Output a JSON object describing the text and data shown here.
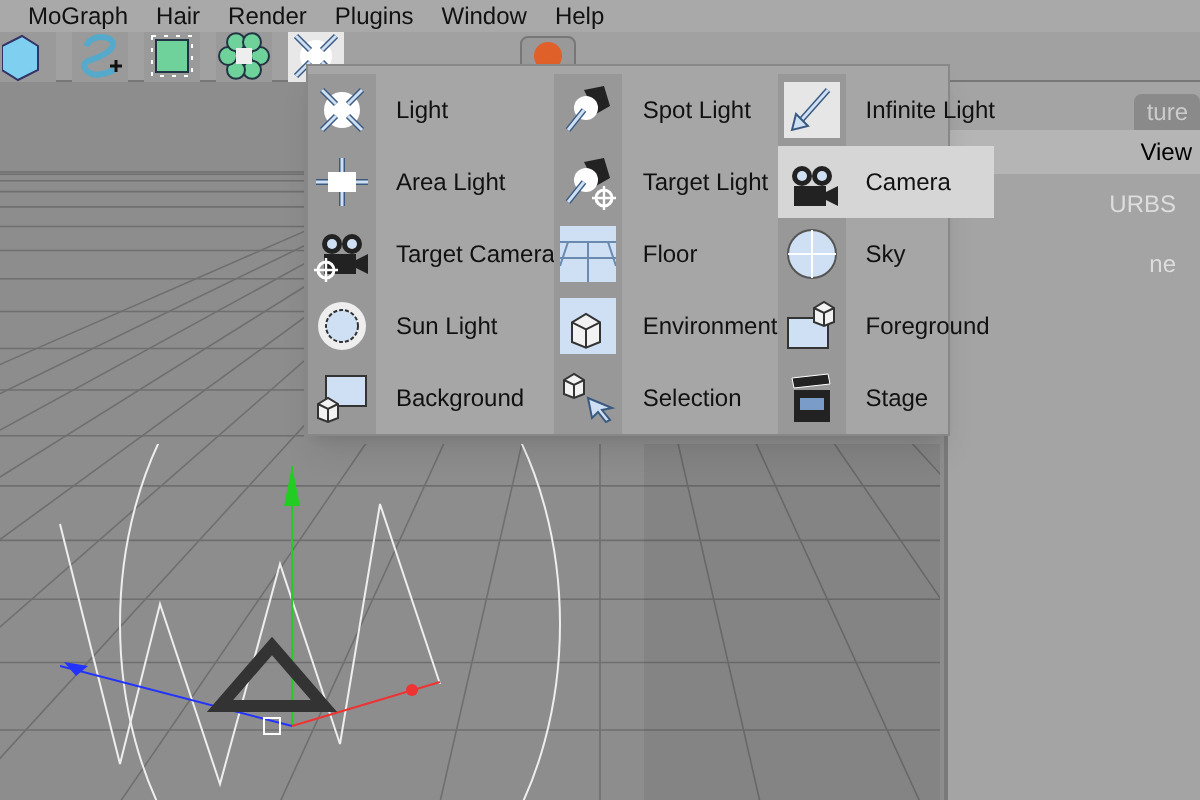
{
  "menu_bar": [
    "MoGraph",
    "Hair",
    "Render",
    "Plugins",
    "Window",
    "Help"
  ],
  "toolbar": [
    {
      "selected": false
    },
    {
      "selected": false
    },
    {
      "selected": false
    },
    {
      "selected": false
    },
    {
      "selected": true
    }
  ],
  "popup": {
    "columns": [
      {
        "items": [
          {
            "label": "Light",
            "selected": false
          },
          {
            "label": "Area Light",
            "selected": false
          },
          {
            "label": "Target Camera",
            "selected": false
          },
          {
            "label": "Sun Light",
            "selected": false
          },
          {
            "label": "Background",
            "selected": false
          }
        ]
      },
      {
        "items": [
          {
            "label": "Spot Light",
            "selected": false
          },
          {
            "label": "Target Light",
            "selected": false
          },
          {
            "label": "Floor",
            "selected": false
          },
          {
            "label": "Environment",
            "selected": false
          },
          {
            "label": "Selection",
            "selected": false
          }
        ]
      },
      {
        "items": [
          {
            "label": "Infinite Light",
            "selected": false
          },
          {
            "label": "Camera",
            "selected": true
          },
          {
            "label": "Sky",
            "selected": false
          },
          {
            "label": "Foreground",
            "selected": false
          },
          {
            "label": "Stage",
            "selected": false
          }
        ]
      }
    ]
  },
  "right_panel": {
    "tab": "ture",
    "menu": "View",
    "rows": [
      "URBS",
      "ne"
    ]
  }
}
